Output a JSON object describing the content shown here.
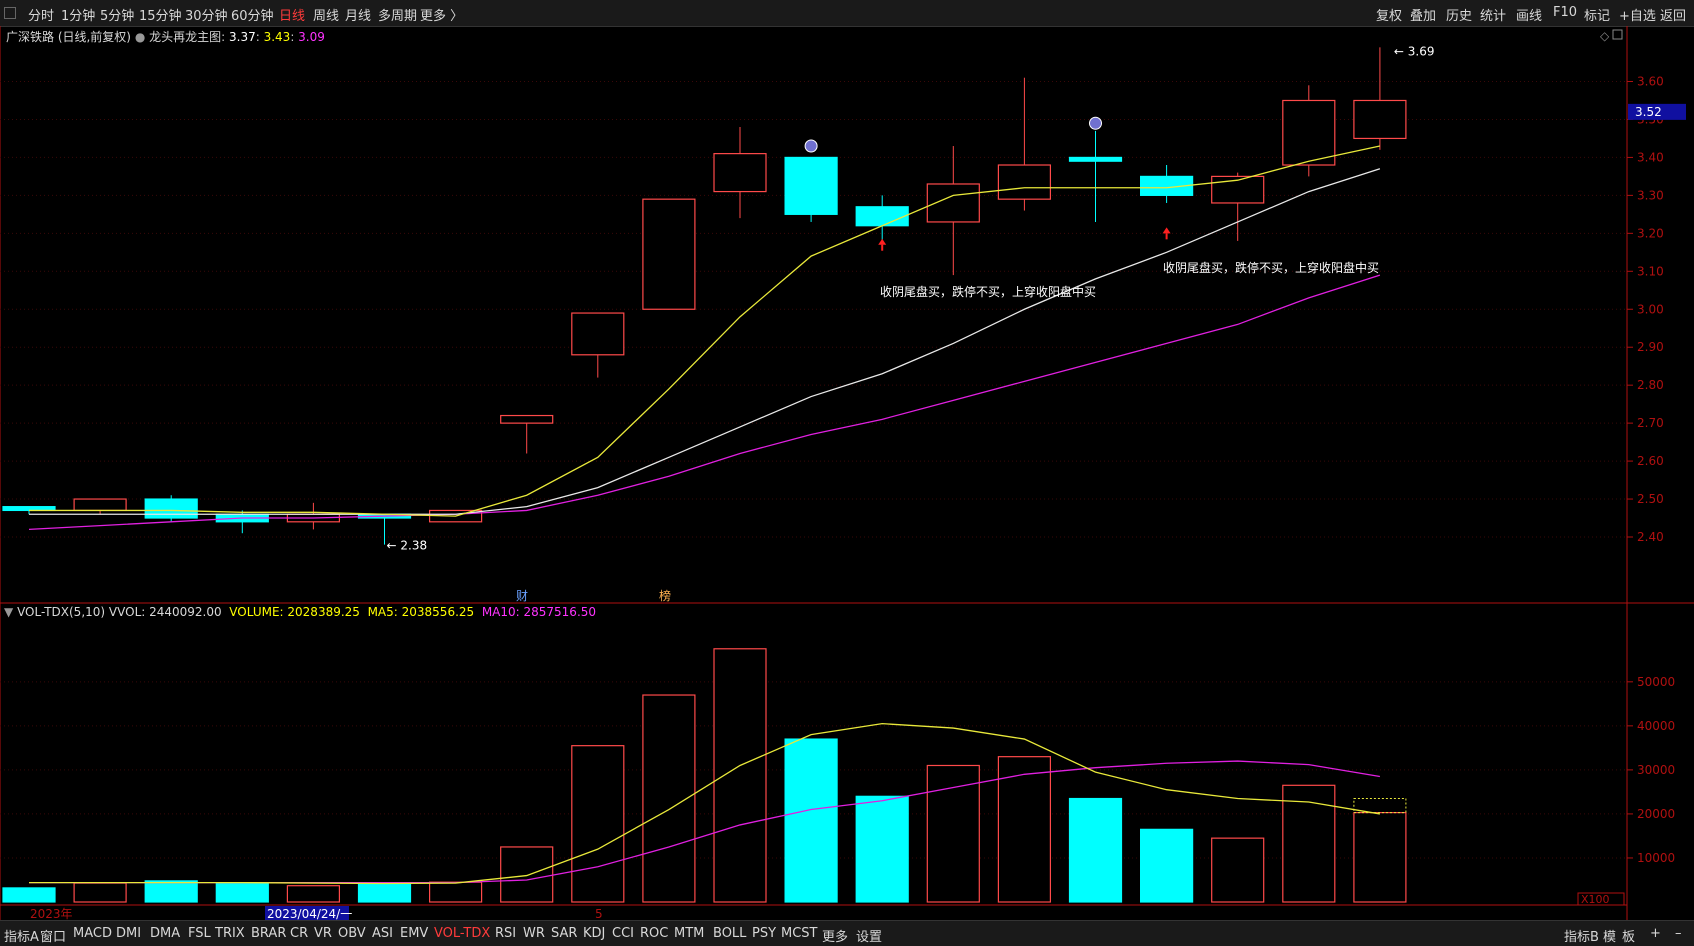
{
  "topbar": {
    "periods": [
      {
        "label": "分时",
        "active": false
      },
      {
        "label": "1分钟",
        "active": false
      },
      {
        "label": "5分钟",
        "active": false
      },
      {
        "label": "15分钟",
        "active": false
      },
      {
        "label": "30分钟",
        "active": false
      },
      {
        "label": "60分钟",
        "active": false
      },
      {
        "label": "日线",
        "active": true
      },
      {
        "label": "周线",
        "active": false
      },
      {
        "label": "月线",
        "active": false
      },
      {
        "label": "多周期",
        "active": false
      },
      {
        "label": "更多 〉",
        "active": false
      }
    ],
    "right_items": [
      "复权",
      "叠加",
      "历史",
      "统计",
      "画线",
      "F10",
      "标记",
      "+自选",
      "返回"
    ]
  },
  "info": {
    "stock": "广深铁路 (日线,前复权)",
    "indicator": "龙头再龙主图",
    "v1": "3.37",
    "v2": "3.43",
    "v3": "3.09",
    "colors": {
      "v1": "#ffffff",
      "v2": "#ffff00",
      "v3": "#ff33ff"
    }
  },
  "vol_info": {
    "name": "VOL-TDX(5,10)",
    "vvol": "VVOL: 2440092.00",
    "volume": "VOLUME: 2028389.25",
    "ma5": "MA5: 2038556.25",
    "ma10": "MA10: 2857516.50"
  },
  "colors": {
    "up": "#ff4a4a",
    "down": "#00ffff",
    "ma_yellow": "#e8e83a",
    "ma_white": "#e8e8e8",
    "ma_magenta": "#e020e0",
    "axis": "#b01010"
  },
  "annotations": {
    "high": "3.69",
    "low": "2.38",
    "text1": "收阴尾盘买，跌停不买，上穿收阳盘中买",
    "text2": "收阴尾盘买，跌停不买，上穿收阳盘中买",
    "event1": "财",
    "event2": "榜"
  },
  "price_axis": {
    "labels": [
      "3.60",
      "3.50",
      "3.40",
      "3.30",
      "3.20",
      "3.10",
      "3.00",
      "2.90",
      "2.80",
      "2.70",
      "2.60",
      "2.50",
      "2.40"
    ],
    "current_price": "3.52"
  },
  "vol_axis": {
    "labels": [
      "50000",
      "40000",
      "30000",
      "20000",
      "10000"
    ],
    "unit": "X100"
  },
  "date_axis": {
    "year_label": "2023年",
    "date_label": "2023/04/24/一",
    "month_label": "5"
  },
  "chart_data": {
    "type": "candlestick",
    "ylim": [
      2.34,
      3.7
    ],
    "candles": [
      {
        "o": 2.48,
        "c": 2.47,
        "h": 2.48,
        "l": 2.46
      },
      {
        "o": 2.47,
        "c": 2.5,
        "h": 2.5,
        "l": 2.46
      },
      {
        "o": 2.5,
        "c": 2.45,
        "h": 2.51,
        "l": 2.44
      },
      {
        "o": 2.46,
        "c": 2.44,
        "h": 2.47,
        "l": 2.41
      },
      {
        "o": 2.44,
        "c": 2.46,
        "h": 2.49,
        "l": 2.42
      },
      {
        "o": 2.46,
        "c": 2.45,
        "h": 2.46,
        "l": 2.38
      },
      {
        "o": 2.44,
        "c": 2.47,
        "h": 2.47,
        "l": 2.44
      },
      {
        "o": 2.7,
        "c": 2.72,
        "h": 2.72,
        "l": 2.62
      },
      {
        "o": 2.88,
        "c": 2.99,
        "h": 2.99,
        "l": 2.82
      },
      {
        "o": 3.0,
        "c": 3.29,
        "h": 3.29,
        "l": 3.0
      },
      {
        "o": 3.31,
        "c": 3.41,
        "h": 3.48,
        "l": 3.24
      },
      {
        "o": 3.4,
        "c": 3.25,
        "h": 3.4,
        "l": 3.23
      },
      {
        "o": 3.27,
        "c": 3.22,
        "h": 3.3,
        "l": 3.17
      },
      {
        "o": 3.23,
        "c": 3.33,
        "h": 3.43,
        "l": 3.09
      },
      {
        "o": 3.29,
        "c": 3.38,
        "h": 3.61,
        "l": 3.26
      },
      {
        "o": 3.4,
        "c": 3.39,
        "h": 3.47,
        "l": 3.23
      },
      {
        "o": 3.35,
        "c": 3.3,
        "h": 3.38,
        "l": 3.28
      },
      {
        "o": 3.28,
        "c": 3.35,
        "h": 3.36,
        "l": 3.18
      },
      {
        "o": 3.38,
        "c": 3.55,
        "h": 3.59,
        "l": 3.35
      },
      {
        "o": 3.45,
        "c": 3.55,
        "h": 3.69,
        "l": 3.42
      }
    ],
    "ma_yellow": [
      2.47,
      2.47,
      2.47,
      2.465,
      2.465,
      2.46,
      2.455,
      2.51,
      2.61,
      2.79,
      2.98,
      3.14,
      3.22,
      3.3,
      3.32,
      3.32,
      3.32,
      3.34,
      3.39,
      3.43
    ],
    "ma_white": [
      2.46,
      2.46,
      2.46,
      2.46,
      2.46,
      2.46,
      2.46,
      2.48,
      2.53,
      2.61,
      2.69,
      2.77,
      2.83,
      2.91,
      3.0,
      3.08,
      3.15,
      3.23,
      3.31,
      3.37
    ],
    "ma_magenta": [
      2.42,
      2.43,
      2.44,
      2.45,
      2.45,
      2.455,
      2.46,
      2.47,
      2.51,
      2.56,
      2.62,
      2.67,
      2.71,
      2.76,
      2.81,
      2.86,
      2.91,
      2.96,
      3.03,
      3.09
    ],
    "volume": [
      3200,
      4300,
      4800,
      4200,
      3700,
      4200,
      4500,
      12500,
      35500,
      47000,
      57500,
      37000,
      24000,
      31000,
      33000,
      23500,
      16500,
      14500,
      26500,
      20300
    ],
    "vol_ma5": [
      4400,
      4400,
      4400,
      4400,
      4300,
      4200,
      4300,
      6000,
      12000,
      21000,
      31000,
      38000,
      40500,
      39500,
      37000,
      29500,
      25500,
      23500,
      22700,
      20000
    ],
    "vol_ma10": [
      4400,
      4400,
      4400,
      4400,
      4400,
      4400,
      4400,
      5000,
      8000,
      12500,
      17500,
      21000,
      23000,
      26000,
      29000,
      30500,
      31500,
      32000,
      31200,
      28500
    ],
    "vol_ylim": [
      0,
      58000
    ]
  }
}
